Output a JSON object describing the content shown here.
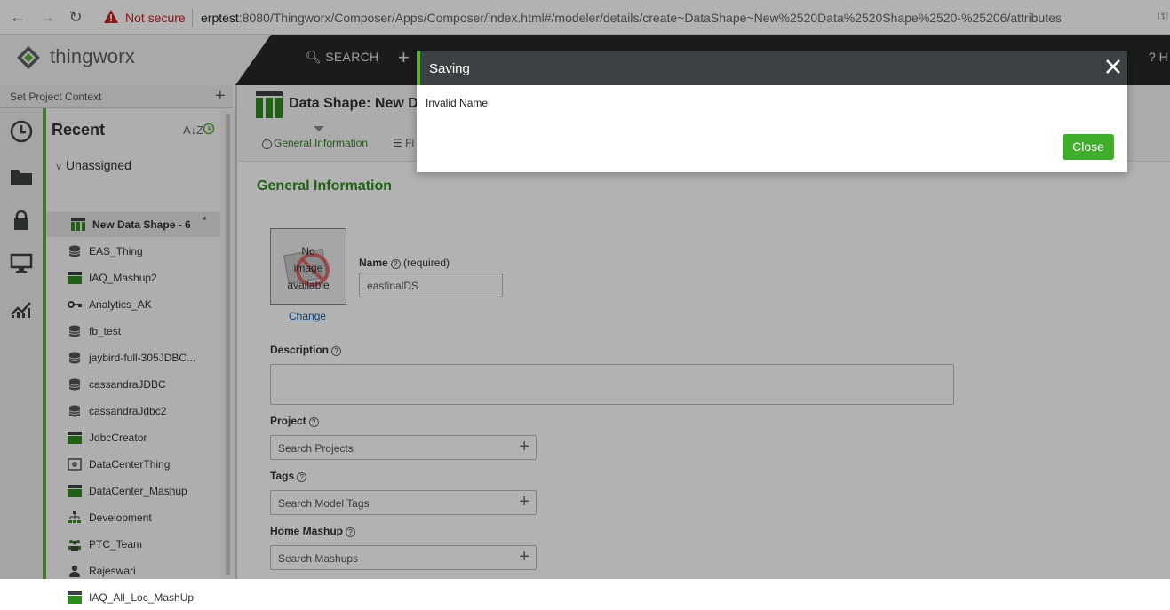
{
  "browser": {
    "security_label": "Not secure",
    "url_host": "erptest",
    "url_rest": ":8080/Thingworx/Composer/Apps/Composer/index.html#/modeler/details/create~DataShape~New%2520Data%2520Shape%2520-%25206/attributes"
  },
  "topbar": {
    "logo_text": "thingworx",
    "search_label": "SEARCH",
    "help_label": "? H"
  },
  "context": {
    "label": "Set Project Context"
  },
  "recent": {
    "title": "Recent",
    "sort_label": "A↓Z",
    "group_label": "Unassigned",
    "items": [
      {
        "label": "New Data Shape - 6",
        "icon": "datashape-icon",
        "modified": "*"
      },
      {
        "label": "EAS_Thing",
        "icon": "database-icon"
      },
      {
        "label": "IAQ_Mashup2",
        "icon": "mashup-icon"
      },
      {
        "label": "Analytics_AK",
        "icon": "key-icon"
      },
      {
        "label": "fb_test",
        "icon": "database-icon"
      },
      {
        "label": "jaybird-full-305JDBC...",
        "icon": "database-icon"
      },
      {
        "label": "cassandraJDBC",
        "icon": "database-icon"
      },
      {
        "label": "cassandraJdbc2",
        "icon": "database-icon"
      },
      {
        "label": "JdbcCreator",
        "icon": "mashup-icon"
      },
      {
        "label": "DataCenterThing",
        "icon": "thing-icon"
      },
      {
        "label": "DataCenter_Mashup",
        "icon": "mashup-icon"
      },
      {
        "label": "Development",
        "icon": "org-icon"
      },
      {
        "label": "PTC_Team",
        "icon": "group-icon"
      },
      {
        "label": "Rajeswari",
        "icon": "user-icon"
      },
      {
        "label": "IAQ_All_Loc_MashUp",
        "icon": "mashup-icon"
      }
    ]
  },
  "page": {
    "title": "Data Shape: New D",
    "tab_general": "General Information",
    "tab_fields": "Fi",
    "section_title": "General Information",
    "no_image_line1": "No",
    "no_image_line2": "image",
    "no_image_line3": "available",
    "change_link": "Change",
    "name_label": "Name",
    "name_required": "(required)",
    "name_value": "easfinalDS",
    "description_label": "Description",
    "project_label": "Project",
    "project_placeholder": "Search Projects",
    "tags_label": "Tags",
    "tags_placeholder": "Search Model Tags",
    "home_mashup_label": "Home Mashup",
    "home_mashup_placeholder": "Search Mashups"
  },
  "modal": {
    "title": "Saving",
    "message": "Invalid Name",
    "close_label": "Close"
  },
  "colors": {
    "accent": "#5bb13a",
    "header": "#3c4143",
    "topbar": "#25282a",
    "button": "#3fae2a"
  }
}
